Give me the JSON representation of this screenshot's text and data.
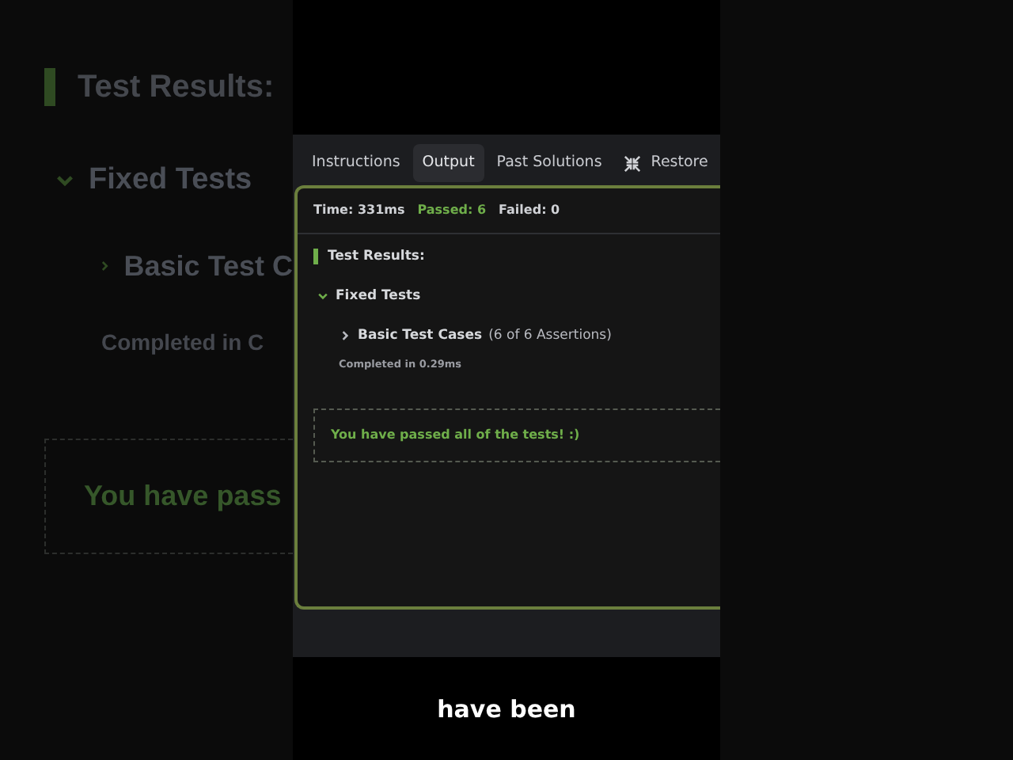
{
  "background_echo": {
    "heading": "Test Results:",
    "group": "Fixed Tests",
    "case": "Basic Test C",
    "completed": "Completed in C",
    "message": "You have pass"
  },
  "tabs": [
    {
      "label": "Instructions",
      "selected": false
    },
    {
      "label": "Output",
      "selected": true
    },
    {
      "label": "Past Solutions",
      "selected": false
    },
    {
      "label": "Restore",
      "selected": false
    }
  ],
  "summary": {
    "time": "Time: 331ms",
    "passed": "Passed: 6",
    "failed": "Failed: 0"
  },
  "results": {
    "heading": "Test Results:",
    "groups": [
      {
        "label": "Fixed Tests",
        "expanded": true,
        "children": [
          {
            "label": "Basic Test Cases",
            "count": "(6 of 6 Assertions)",
            "expanded": false,
            "completed": "Completed in 0.29ms"
          }
        ]
      }
    ],
    "message": "You have passed all of the tests! :)"
  },
  "caption": "have been"
}
